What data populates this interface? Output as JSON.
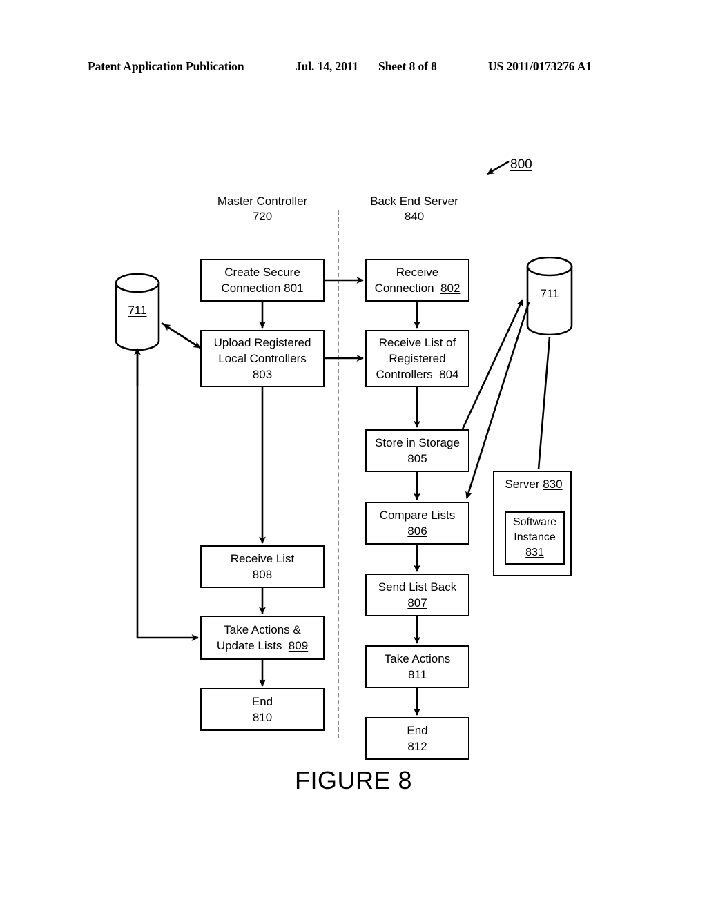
{
  "header": {
    "publication": "Patent Application Publication",
    "date": "Jul. 14, 2011",
    "sheet": "Sheet 8 of 8",
    "number": "US 2011/0173276 A1"
  },
  "figure": {
    "caption": "FIGURE 8",
    "reference_numeral": "800"
  },
  "lanes": [
    {
      "name": "master-controller",
      "title": "Master Controller",
      "numeral": "720",
      "numeral_underlined": false
    },
    {
      "name": "back-end-server",
      "title": "Back End Server",
      "numeral": "840",
      "numeral_underlined": true
    }
  ],
  "datastores": [
    {
      "name": "storage-left",
      "numeral": "711"
    },
    {
      "name": "storage-right",
      "numeral": "711"
    }
  ],
  "boxes": [
    {
      "id": "801",
      "lane": "master-controller",
      "lines": [
        "Create Secure",
        "Connection  801"
      ],
      "numeral": "801",
      "numeral_underlined": false
    },
    {
      "id": "803",
      "lane": "master-controller",
      "lines": [
        "Upload Registered",
        "Local Controllers",
        "803"
      ],
      "numeral": "803",
      "numeral_underlined": false
    },
    {
      "id": "808",
      "lane": "master-controller",
      "lines": [
        "Receive List",
        "808"
      ],
      "numeral": "808",
      "numeral_underlined": true
    },
    {
      "id": "809",
      "lane": "master-controller",
      "lines": [
        "Take Actions &",
        "Update Lists  809"
      ],
      "numeral": "809",
      "numeral_underlined": true
    },
    {
      "id": "810",
      "lane": "master-controller",
      "lines": [
        "End",
        "810"
      ],
      "numeral": "810",
      "numeral_underlined": true
    },
    {
      "id": "802",
      "lane": "back-end-server",
      "lines": [
        "Receive",
        "Connection  802"
      ],
      "numeral": "802",
      "numeral_underlined": true
    },
    {
      "id": "804",
      "lane": "back-end-server",
      "lines": [
        "Receive List of",
        "Registered",
        "Controllers  804"
      ],
      "numeral": "804",
      "numeral_underlined": true
    },
    {
      "id": "805",
      "lane": "back-end-server",
      "lines": [
        "Store in Storage",
        "805"
      ],
      "numeral": "805",
      "numeral_underlined": true
    },
    {
      "id": "806",
      "lane": "back-end-server",
      "lines": [
        "Compare Lists",
        "806"
      ],
      "numeral": "806",
      "numeral_underlined": true
    },
    {
      "id": "807",
      "lane": "back-end-server",
      "lines": [
        "Send List Back",
        "807"
      ],
      "numeral": "807",
      "numeral_underlined": true
    },
    {
      "id": "811",
      "lane": "back-end-server",
      "lines": [
        "Take Actions",
        "811"
      ],
      "numeral": "811",
      "numeral_underlined": true
    },
    {
      "id": "812",
      "lane": "back-end-server",
      "lines": [
        "End",
        "812"
      ],
      "numeral": "812",
      "numeral_underlined": true
    }
  ],
  "server": {
    "title": "Server",
    "numeral": "830",
    "instance_title_line1": "Software",
    "instance_title_line2": "Instance",
    "instance_numeral": "831"
  },
  "box_text": {
    "b801_l1": "Create Secure",
    "b801_l2": "Connection  801",
    "b803_l1": "Upload Registered",
    "b803_l2": "Local Controllers",
    "b803_l3": "803",
    "b808_l1": "Receive List",
    "b808_l2": "808",
    "b809_l1": "Take Actions &",
    "b809_l2": "Update Lists  809",
    "b810_l1": "End",
    "b810_l2": "810",
    "b802_l1": "Receive",
    "b802_l2": "Connection  802",
    "b804_l1": "Receive List of",
    "b804_l2": "Registered",
    "b804_l3": "Controllers  804",
    "b805_l1": "Store in Storage",
    "b805_l2": "805",
    "b806_l1": "Compare Lists",
    "b806_l2": "806",
    "b807_l1": "Send List Back",
    "b807_l2": "807",
    "b811_l1": "Take Actions",
    "b811_l2": "811",
    "b812_l1": "End",
    "b812_l2": "812"
  },
  "colors": {
    "ink": "#000000",
    "paper": "#ffffff",
    "divider": "#888888"
  }
}
